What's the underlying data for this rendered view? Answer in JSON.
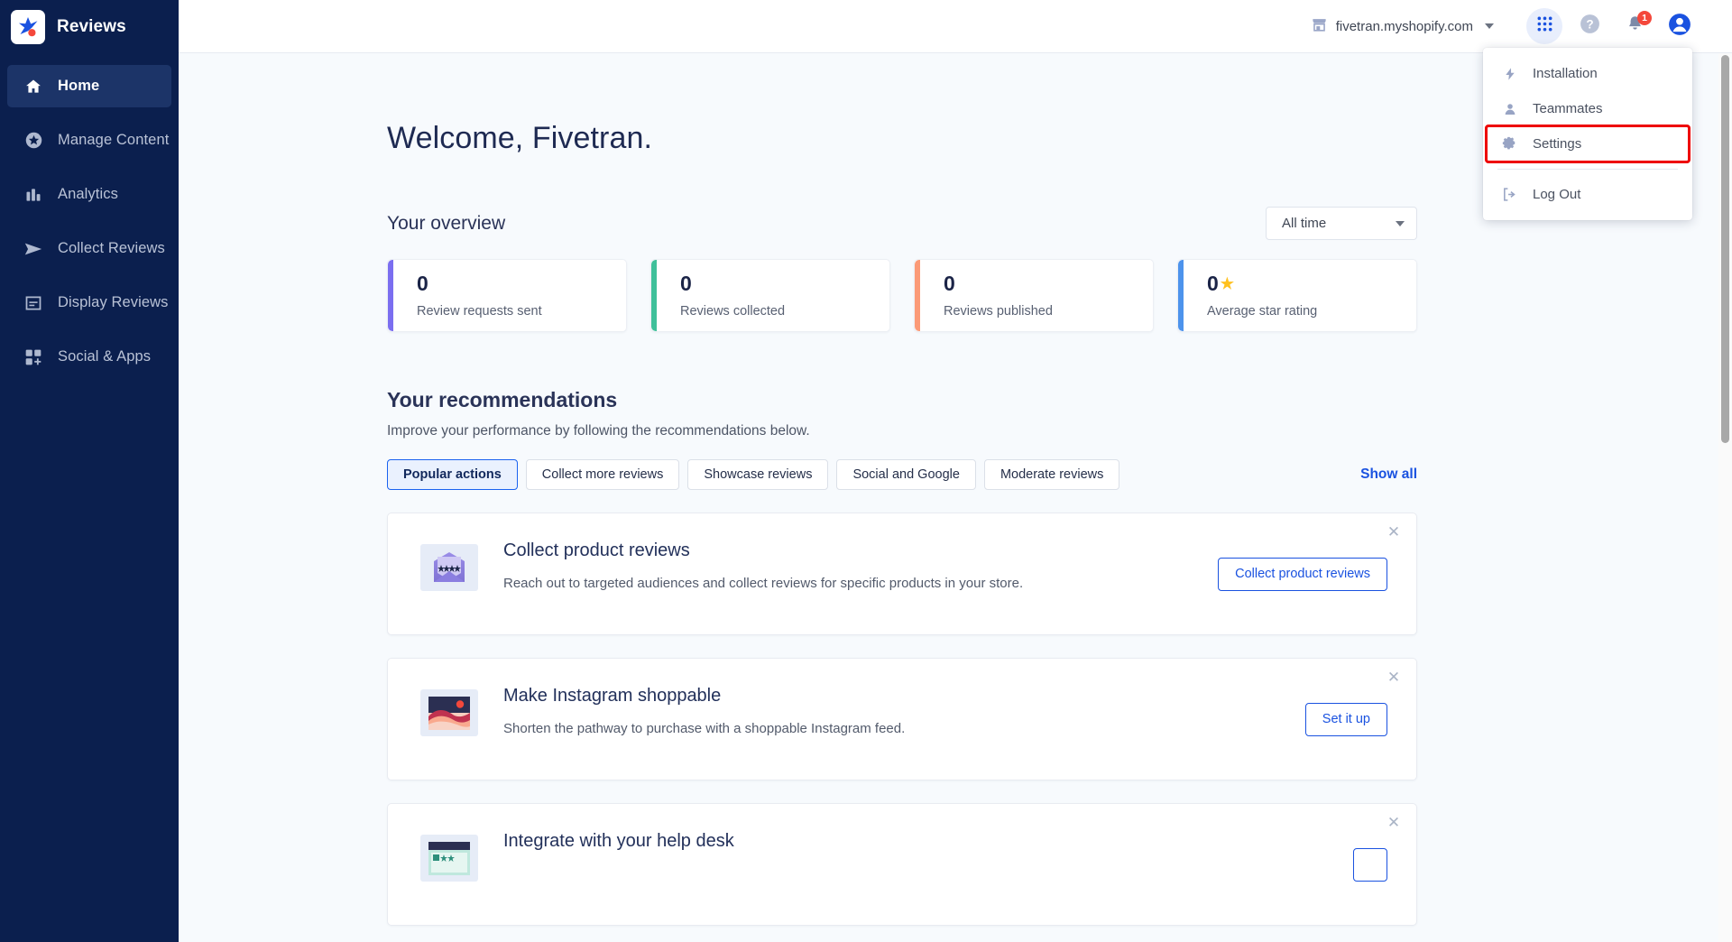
{
  "sidebar": {
    "brand": {
      "name": "Reviews",
      "logo_icon": "star-sparkle-logo"
    },
    "items": [
      {
        "label": "Home",
        "icon": "home-icon",
        "active": true
      },
      {
        "label": "Manage Content",
        "icon": "star-circle-icon",
        "active": false
      },
      {
        "label": "Analytics",
        "icon": "bar-chart-icon",
        "active": false
      },
      {
        "label": "Collect Reviews",
        "icon": "send-icon",
        "active": false
      },
      {
        "label": "Display Reviews",
        "icon": "window-list-icon",
        "active": false
      },
      {
        "label": "Social & Apps",
        "icon": "apps-grid-icon",
        "active": false
      }
    ]
  },
  "topbar": {
    "store": "fivetran.myshopify.com",
    "store_icon": "storefront-icon",
    "apps_icon": "grid-apps-icon",
    "help_icon": "question-mark-icon",
    "notifications_icon": "bell-icon",
    "notifications_count": "1",
    "account_icon": "account-avatar-icon"
  },
  "account_menu": {
    "items": [
      {
        "label": "Installation",
        "icon": "lightning-bolt-icon",
        "highlighted": false
      },
      {
        "label": "Teammates",
        "icon": "person-icon",
        "highlighted": false
      },
      {
        "label": "Settings",
        "icon": "gear-icon",
        "highlighted": true
      }
    ],
    "logout": {
      "label": "Log Out",
      "icon": "logout-arrow-icon"
    }
  },
  "main": {
    "welcome": "Welcome, Fivetran.",
    "overview_title": "Your overview",
    "time_filter": {
      "value": "All time",
      "chevron_icon": "chevron-down-icon"
    },
    "stats": [
      {
        "value": "0",
        "label": "Review requests sent",
        "color": "#7b6ef0",
        "star": false
      },
      {
        "value": "0",
        "label": "Reviews collected",
        "color": "#3fc09a",
        "star": false
      },
      {
        "value": "0",
        "label": "Reviews published",
        "color": "#fb9a77",
        "star": false
      },
      {
        "value": "0",
        "label": "Average star rating",
        "color": "#4d93ec",
        "star": true
      }
    ],
    "recommendations": {
      "title": "Your recommendations",
      "subtitle": "Improve your performance by following the recommendations below.",
      "tabs": [
        {
          "label": "Popular actions",
          "active": true
        },
        {
          "label": "Collect more reviews",
          "active": false
        },
        {
          "label": "Showcase reviews",
          "active": false
        },
        {
          "label": "Social and Google",
          "active": false
        },
        {
          "label": "Moderate reviews",
          "active": false
        }
      ],
      "show_all": "Show all",
      "cards": [
        {
          "title": "Collect product reviews",
          "desc": "Reach out to targeted audiences and collect reviews for specific products in your store.",
          "button": "Collect product reviews",
          "thumb": "envelope-stars-thumb",
          "close_icon": "close-icon"
        },
        {
          "title": "Make Instagram shoppable",
          "desc": "Shorten the pathway to purchase with a shoppable Instagram feed.",
          "button": "Set it up",
          "thumb": "photo-landscape-thumb",
          "close_icon": "close-icon"
        },
        {
          "title": "Integrate with your help desk",
          "desc": "",
          "button": "",
          "thumb": "helpdesk-window-thumb",
          "close_icon": "close-icon"
        }
      ]
    }
  },
  "colors": {
    "sidebar_bg": "#0b1f4e",
    "accent_blue": "#1a52e0",
    "page_bg": "#f7fafd",
    "highlight_red": "#ee0000"
  }
}
